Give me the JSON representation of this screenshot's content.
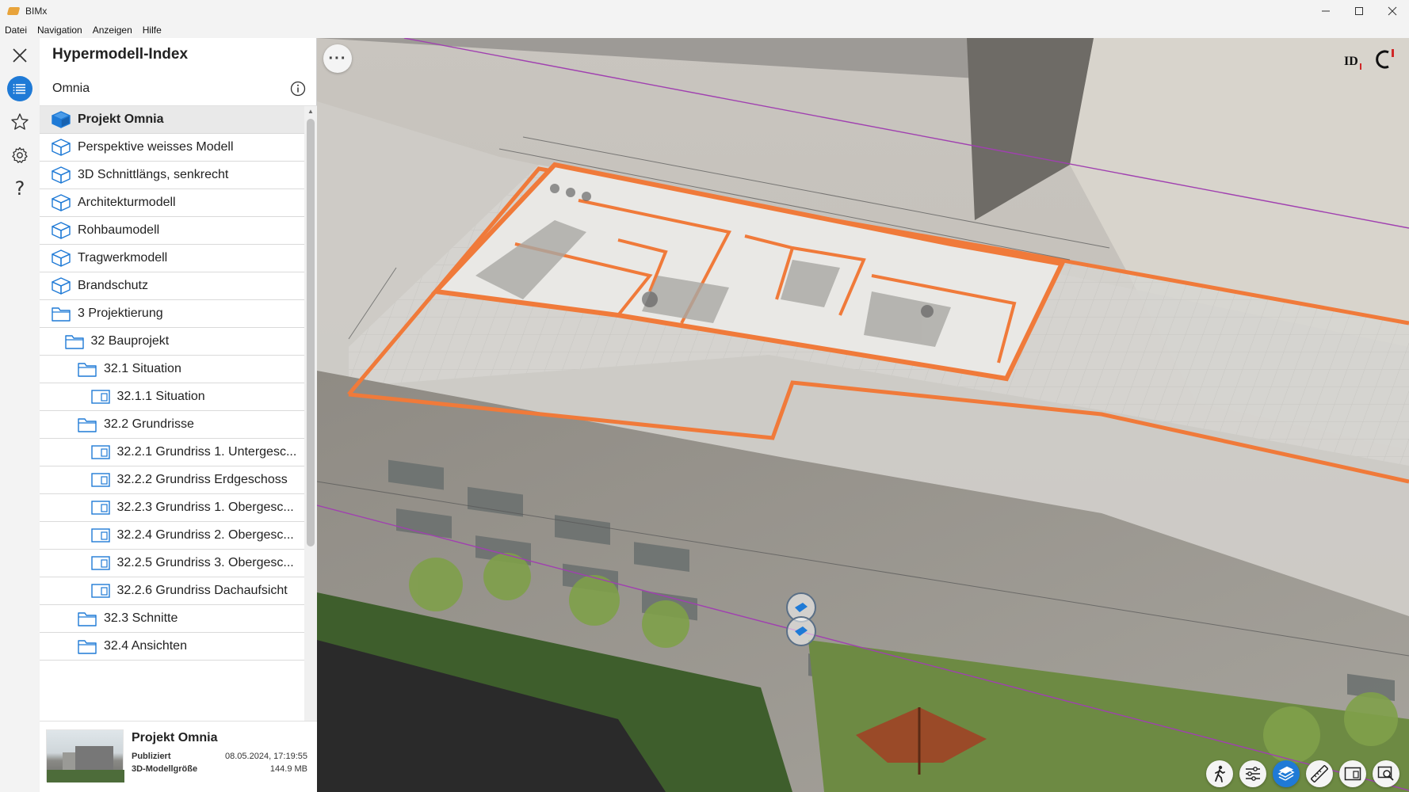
{
  "window": {
    "title": "BIMx",
    "controls": {
      "minimize": "—",
      "maximize": "☐",
      "close": "✕"
    }
  },
  "menubar": {
    "items": [
      "Datei",
      "Navigation",
      "Anzeigen",
      "Hilfe"
    ]
  },
  "rail": {
    "items": [
      {
        "icon": "close-icon"
      },
      {
        "icon": "list-icon",
        "active": true
      },
      {
        "icon": "star-icon"
      },
      {
        "icon": "gear-icon"
      },
      {
        "icon": "help-icon",
        "glyph": "?"
      }
    ]
  },
  "panel": {
    "title": "Hypermodell-Index",
    "search": {
      "value": "Omnia"
    },
    "tree": [
      {
        "label": "Projekt Omnia",
        "icon": "cube-icon",
        "level": 0,
        "selected": true,
        "filled": true
      },
      {
        "label": "Perspektive weisses Modell",
        "icon": "cube-icon",
        "level": 0
      },
      {
        "label": "3D Schnittlängs, senkrecht",
        "icon": "cube-icon",
        "level": 0
      },
      {
        "label": "Architekturmodell",
        "icon": "cube-icon",
        "level": 0
      },
      {
        "label": "Rohbaumodell",
        "icon": "cube-icon",
        "level": 0
      },
      {
        "label": "Tragwerkmodell",
        "icon": "cube-icon",
        "level": 0
      },
      {
        "label": "Brandschutz",
        "icon": "cube-icon",
        "level": 0
      },
      {
        "label": "3 Projektierung",
        "icon": "folder-icon",
        "level": 0
      },
      {
        "label": "32 Bauprojekt",
        "icon": "folder-icon",
        "level": 1
      },
      {
        "label": "32.1 Situation",
        "icon": "folder-icon",
        "level": 2
      },
      {
        "label": "32.1.1 Situation",
        "icon": "layout-sheet-icon",
        "level": 3
      },
      {
        "label": "32.2 Grundrisse",
        "icon": "folder-icon",
        "level": 2
      },
      {
        "label": "32.2.1 Grundriss 1. Untergesc...",
        "icon": "layout-sheet-icon",
        "level": 3
      },
      {
        "label": "32.2.2 Grundriss Erdgeschoss",
        "icon": "layout-sheet-icon",
        "level": 3
      },
      {
        "label": "32.2.3 Grundriss 1. Obergesc...",
        "icon": "layout-sheet-icon",
        "level": 3
      },
      {
        "label": "32.2.4 Grundriss 2. Obergesc...",
        "icon": "layout-sheet-icon",
        "level": 3
      },
      {
        "label": "32.2.5 Grundriss 3. Obergesc...",
        "icon": "layout-sheet-icon",
        "level": 3
      },
      {
        "label": "32.2.6 Grundriss Dachaufsicht",
        "icon": "layout-sheet-icon",
        "level": 3
      },
      {
        "label": "32.3 Schnitte",
        "icon": "folder-icon",
        "level": 2
      },
      {
        "label": "32.4 Ansichten",
        "icon": "folder-icon",
        "level": 2
      }
    ],
    "footer": {
      "title": "Projekt Omnia",
      "published_label": "Publiziert",
      "published_value": "08.05.2024, 17:19:55",
      "size_label": "3D-Modellgröße",
      "size_value": "144.9 MB"
    }
  },
  "viewport": {
    "more_label": "···",
    "logo_text": "ID",
    "tools": [
      {
        "icon": "walk-icon"
      },
      {
        "icon": "sliders-icon"
      },
      {
        "icon": "layers-icon",
        "active": true
      },
      {
        "icon": "ruler-icon"
      },
      {
        "icon": "layout-sheet-icon"
      },
      {
        "icon": "zoom-window-icon"
      }
    ]
  },
  "colors": {
    "accent": "#1f7ad6",
    "panel_bg": "#ffffff",
    "rail_bg": "#f3f3f3",
    "selection_bg": "#e9e9e9",
    "wall_highlight": "#f07a3a"
  }
}
